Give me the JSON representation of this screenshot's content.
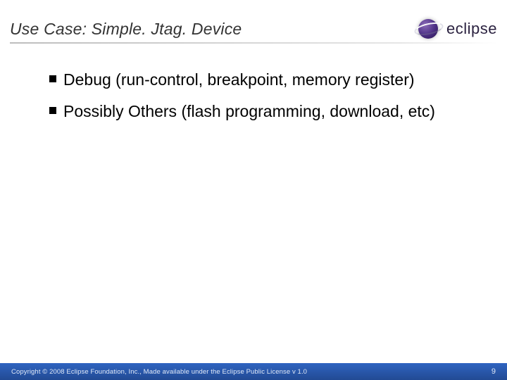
{
  "header": {
    "title": "Use Case: Simple. Jtag. Device",
    "logo_text": "eclipse"
  },
  "bullets": [
    {
      "text": "Debug (run-control, breakpoint, memory register)"
    },
    {
      "text": "Possibly Others (flash programming, download, etc)"
    }
  ],
  "footer": {
    "copyright": "Copyright © 2008 Eclipse Foundation, Inc., Made available under the Eclipse Public License v 1.0",
    "page_number": "9"
  }
}
